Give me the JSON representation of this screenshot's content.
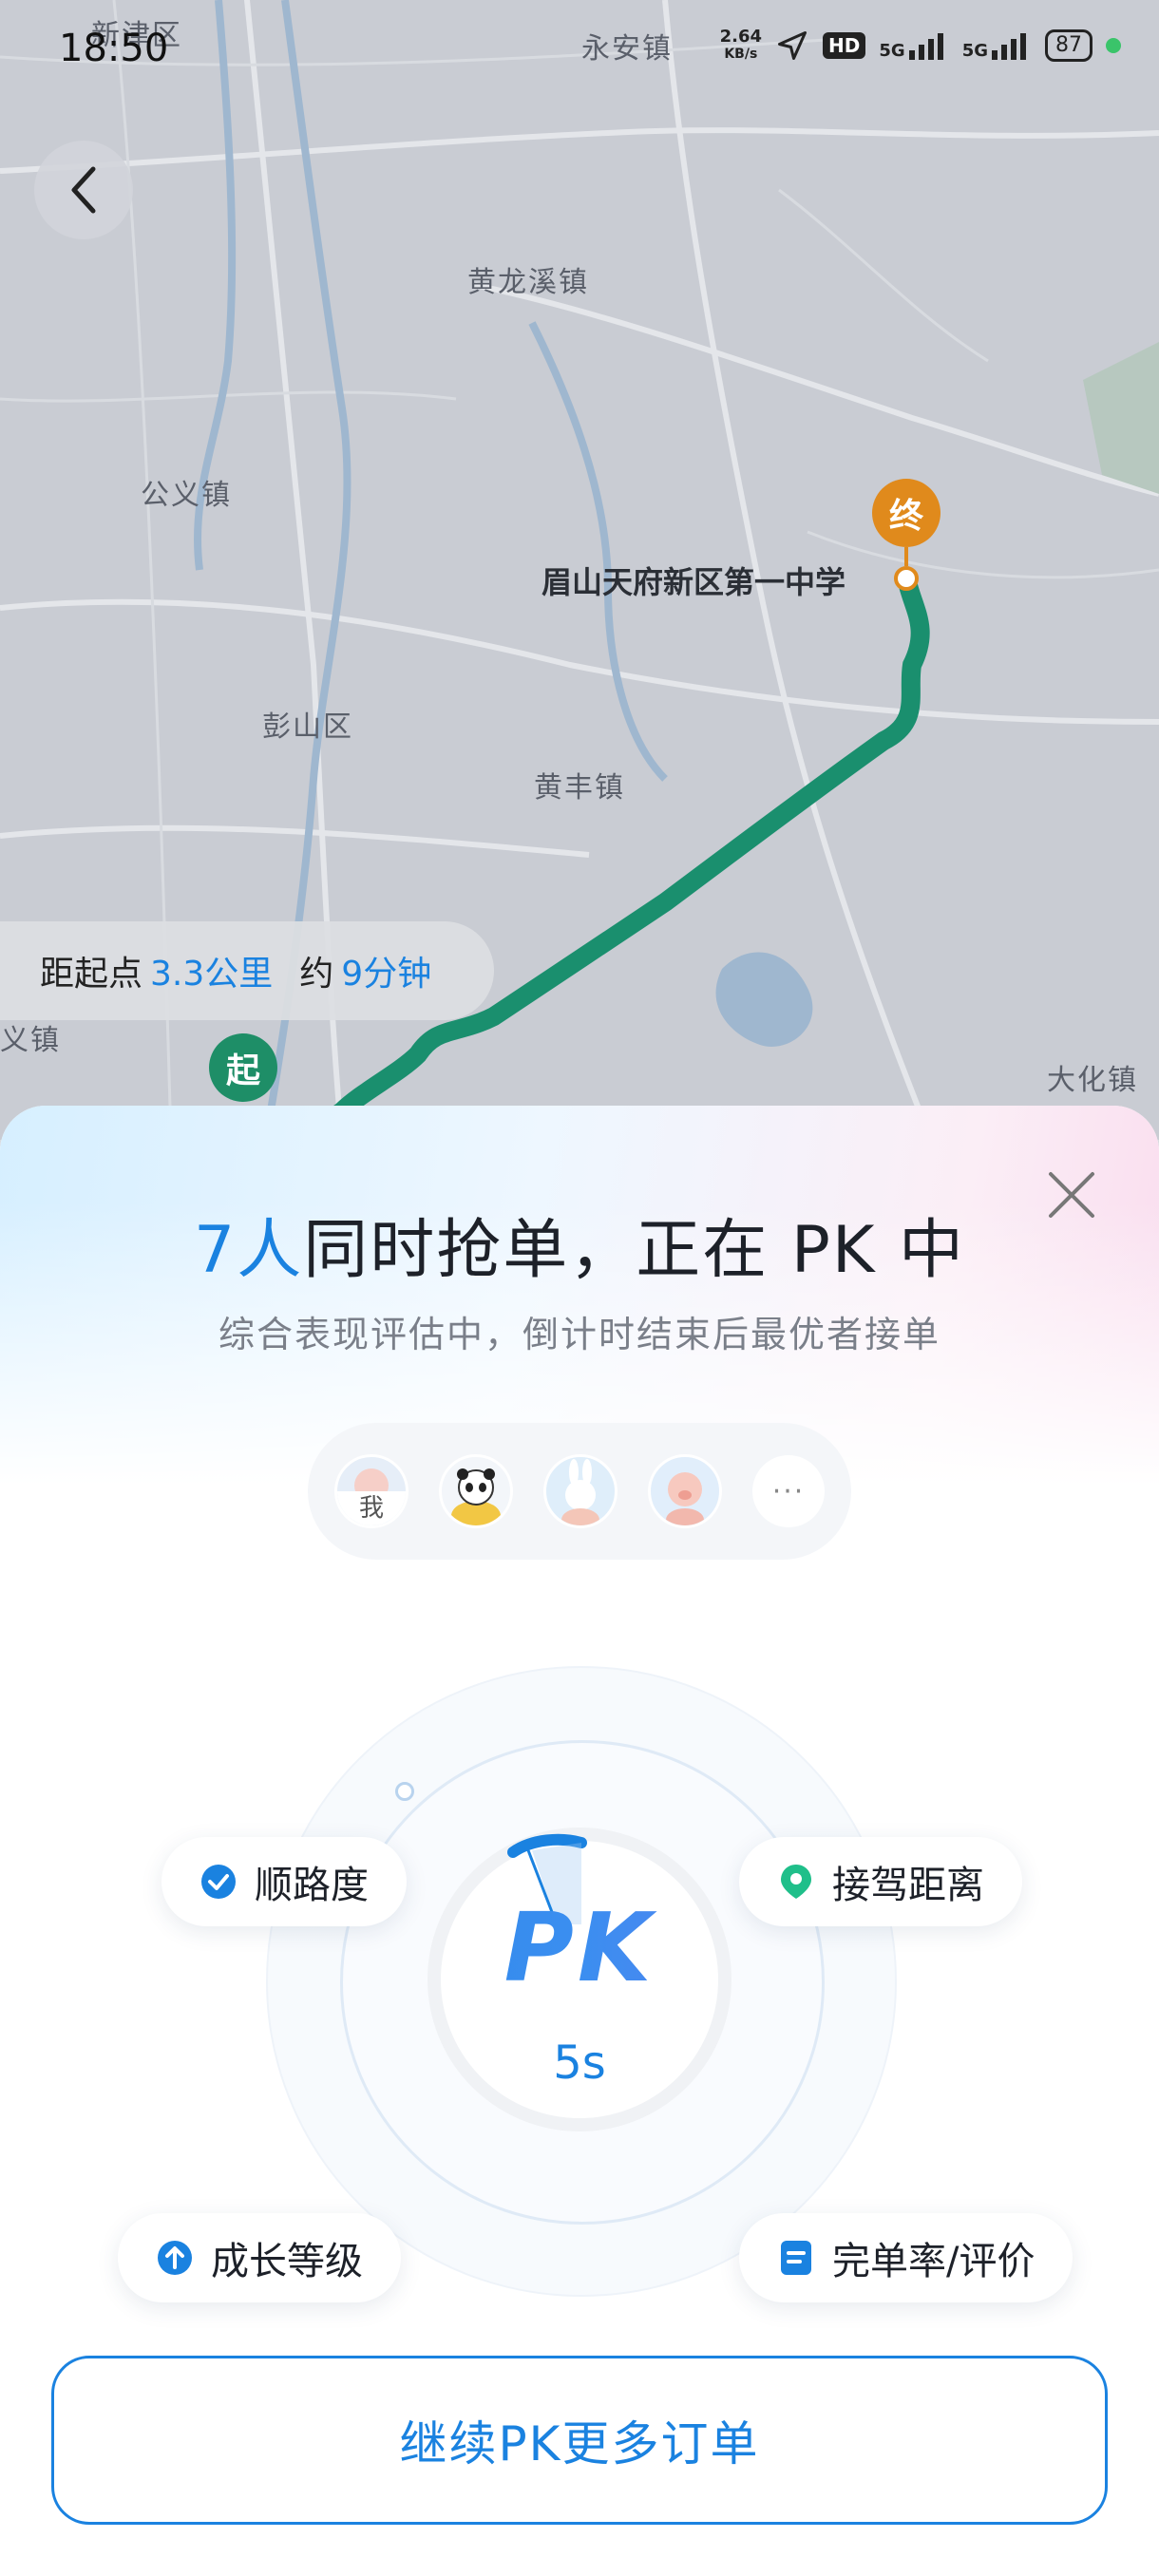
{
  "status_bar": {
    "time": "18:50",
    "net_speed_value": "2.64",
    "net_speed_unit": "KB/s",
    "hd_label": "HD",
    "signal_1": "5G",
    "signal_2": "5G",
    "battery": "87"
  },
  "map": {
    "labels": {
      "xinjin": "新津区",
      "yongan": "永安镇",
      "huanglongxi": "黄龙溪镇",
      "gongyi": "公义镇",
      "pengshan": "彭山区",
      "huangfeng": "黄丰镇",
      "yi": "义镇",
      "dahua": "大化镇",
      "destination_name": "眉山天府新区第一中学"
    },
    "end_pin_label": "终",
    "start_pin_label": "起",
    "route_color": "#1a8f6e"
  },
  "distance_pill": {
    "prefix": "距起点",
    "distance": "3.3公里",
    "mid": "约",
    "duration": "9分钟"
  },
  "sheet": {
    "headline_num": "7人",
    "headline_rest": "同时抢单，正在 PK 中",
    "subline": "综合表现评估中，倒计时结束后最优者接单",
    "avatars": {
      "me_label": "我",
      "more_label": "···"
    },
    "pk_label": "PK",
    "countdown": "5s",
    "chips": {
      "route_fit": "顺路度",
      "pickup_distance": "接驾距离",
      "growth_level": "成长等级",
      "completion_rating": "完单率/评价"
    },
    "continue_button": "继续PK更多订单"
  },
  "colors": {
    "accent_blue": "#1a82e0",
    "route_green": "#1a8f6e",
    "end_pin_orange": "#e08a1c",
    "start_pin_green": "#1e8e67"
  }
}
